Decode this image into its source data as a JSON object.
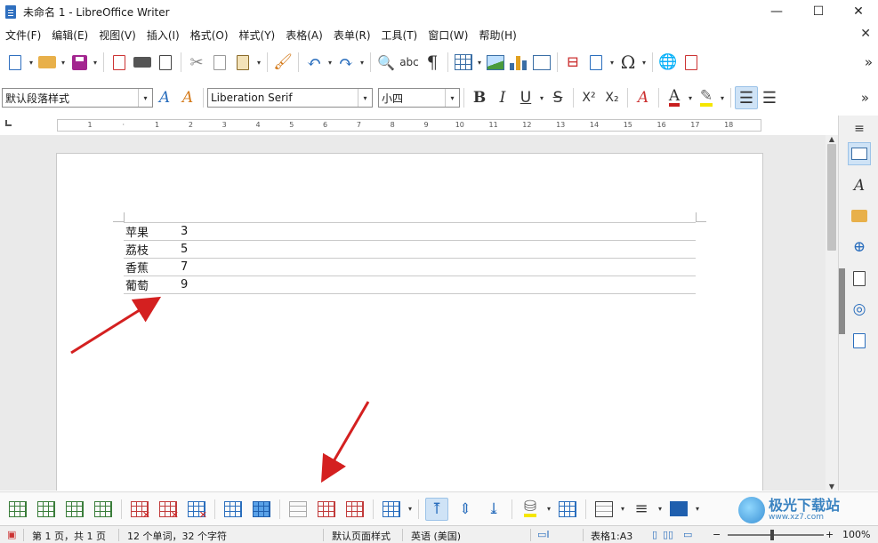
{
  "window": {
    "title": "未命名 1 - LibreOffice Writer",
    "minimize": "—",
    "maximize": "☐",
    "close": "✕"
  },
  "menu": [
    "文件(F)",
    "编辑(E)",
    "视图(V)",
    "插入(I)",
    "格式(O)",
    "样式(Y)",
    "表格(A)",
    "表单(R)",
    "工具(T)",
    "窗口(W)",
    "帮助(H)"
  ],
  "formatting": {
    "paragraph_style": "默认段落样式",
    "font_name": "Liberation Serif",
    "font_size": "小四",
    "bold": "B",
    "italic": "I",
    "underline": "U",
    "strike": "S",
    "superscript": "X²",
    "subscript": "X₂"
  },
  "ruler": {
    "ticks": [
      "1",
      "·",
      "1",
      "2",
      "3",
      "4",
      "5",
      "6",
      "7",
      "8",
      "9",
      "10",
      "11",
      "12",
      "13",
      "14",
      "15",
      "16",
      "17",
      "18"
    ]
  },
  "document": {
    "table": [
      [
        "苹果",
        "3",
        ""
      ],
      [
        "荔枝",
        "5",
        ""
      ],
      [
        "香蕉",
        "7",
        ""
      ],
      [
        "葡萄",
        "9",
        ""
      ]
    ]
  },
  "statusbar": {
    "page": "第 1 页，共 1 页",
    "words": "12 个单词，32 个字符",
    "page_style": "默认页面样式",
    "language": "英语 (美国)",
    "cell": "表格1:A3",
    "zoom": "100%"
  },
  "watermark": {
    "line1": "极光下载站",
    "line2": "www.xz7.com"
  },
  "colors": {
    "accent_blue": "#2a6ebd",
    "arrow_red": "#d42020",
    "font_color_red": "#c81e1e",
    "highlight_yellow": "#f5e600"
  }
}
